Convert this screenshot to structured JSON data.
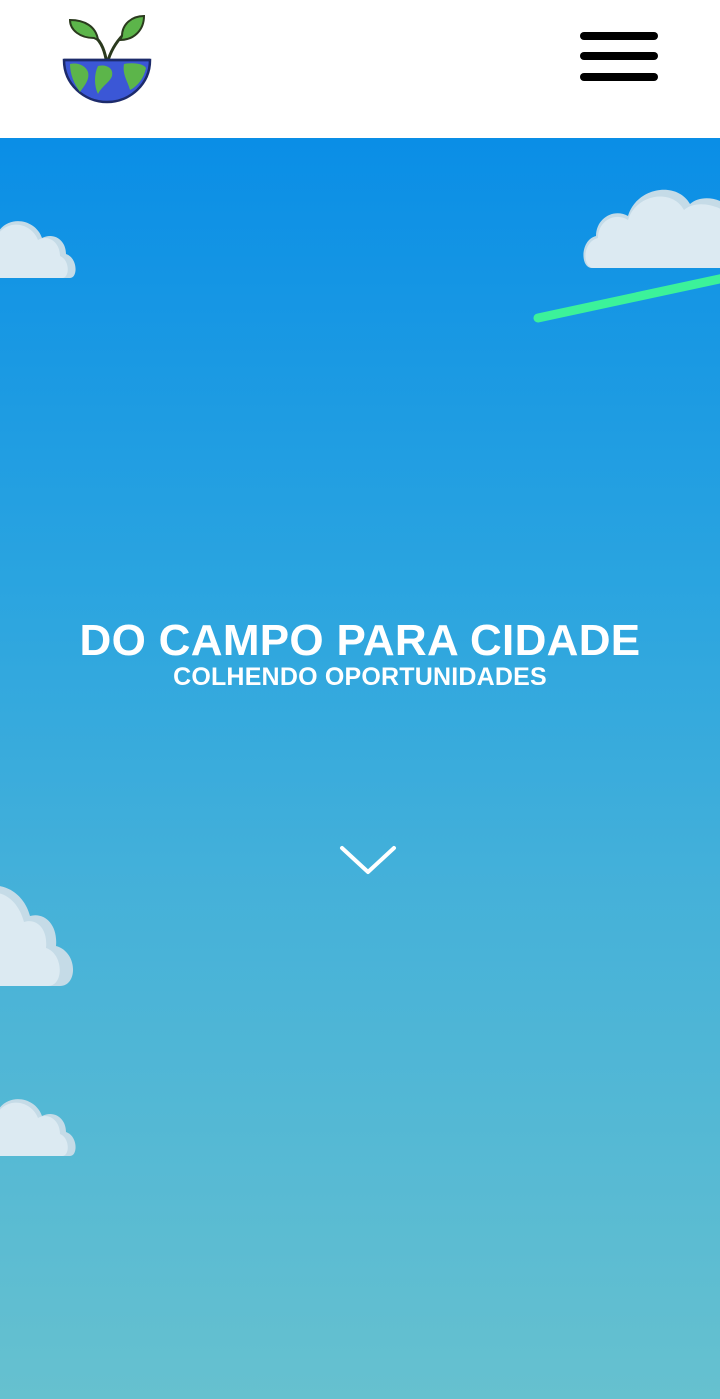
{
  "header": {
    "logo_icon": "plant-globe-logo-icon",
    "menu_icon": "hamburger-menu-icon"
  },
  "hero": {
    "title": "DO CAMPO PARA CIDADE",
    "subtitle": "COLHENDO OPORTUNIDADES",
    "scroll_icon": "chevron-down-icon"
  },
  "colors": {
    "sky_top": "#0a8ee6",
    "sky_bottom": "#66c1cf",
    "cloud": "#dceaf2",
    "cloud_shadow": "#c5dbe7",
    "streak": "#3cf29a",
    "menu": "#000000",
    "text": "#ffffff"
  }
}
